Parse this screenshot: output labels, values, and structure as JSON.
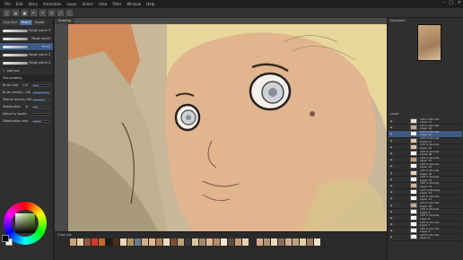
{
  "menu": [
    "File",
    "Edit",
    "Story",
    "Animation",
    "Layer",
    "Select",
    "View",
    "Filter",
    "Window",
    "Help"
  ],
  "tool_panel": {
    "tabs": [
      "Sub Tool",
      "Pencil",
      "Pastel"
    ],
    "brushes": [
      {
        "name": "Rough pencil 3",
        "selected": false
      },
      {
        "name": "Rough pencil",
        "selected": false
      },
      {
        "name": "Pencil",
        "selected": true
      },
      {
        "name": "Rough pencil 2",
        "selected": false
      },
      {
        "name": "Rough pencil 4",
        "selected": false
      }
    ],
    "add_button": "Add tool",
    "properties_title": "Tool property",
    "props": [
      {
        "label": "Brush Size",
        "value": "4.0",
        "level": 0.35
      },
      {
        "label": "Brush density",
        "value": "100",
        "level": 1.0
      },
      {
        "label": "Texture density",
        "value": "100",
        "level": 0.7
      },
      {
        "label": "Stabilization",
        "value": "6",
        "level": 0.3
      },
      {
        "label": "Adjust by speed",
        "value": "",
        "level": 0
      },
      {
        "label": "Stabilization step",
        "value": "",
        "level": 0.5
      }
    ]
  },
  "canvas": {
    "tab_label": "drawing"
  },
  "palette": {
    "label": "Color set",
    "colors": [
      "#c7a27a",
      "#e6c9a8",
      "#8a5a3c",
      "#d33a2c",
      "#c96a2a",
      "#1b1b1b",
      "#4b2a1d",
      "#e9d9b5",
      "#b3935f",
      "#6b7a8f",
      "#cfb08a",
      "#e3b48f",
      "#a77a57",
      "#f1dcc3",
      "#7a4e33",
      "#c2a076",
      "#3a3a3a",
      "#d9c49a",
      "#9e8a6a",
      "#e0b590",
      "#bb8a66",
      "#f4e6cf",
      "#5d4a3a",
      "#c79a78",
      "#e6d2ad",
      "#2a2a2a",
      "#d8a88a",
      "#a99272",
      "#efd7bb",
      "#85705a",
      "#cfae8c",
      "#b9a582",
      "#e7cfa4",
      "#9d7b5c",
      "#f0e0c5"
    ]
  },
  "right_panel": {
    "navigator_label": "Navigator",
    "layer_label": "Layer",
    "layers": [
      {
        "name": "100 % Normal",
        "sub": "Layer 23",
        "selected": false,
        "thumb": "#e8e3d6"
      },
      {
        "name": "100 % Normal",
        "sub": "Layer 19",
        "selected": false,
        "thumb": "#c9a888"
      },
      {
        "name": "100 % Normal",
        "sub": "Layer 22",
        "selected": true,
        "thumb": "#ffffff"
      },
      {
        "name": "100 % Normal",
        "sub": "Layer 21",
        "selected": false,
        "thumb": "#e0c7a9"
      },
      {
        "name": "100 % Normal",
        "sub": "Layer 20",
        "selected": false,
        "thumb": "#dcc2a2"
      },
      {
        "name": "100 % Normal",
        "sub": "Layer 18",
        "selected": false,
        "thumb": "#ffffff"
      },
      {
        "name": "100 % Normal",
        "sub": "Layer 17",
        "selected": false,
        "thumb": "#c89f7f"
      },
      {
        "name": "100 % Normal",
        "sub": "Layer 16",
        "selected": false,
        "thumb": "#ffffff"
      },
      {
        "name": "100 % Normal",
        "sub": "Layer 15",
        "selected": false,
        "thumb": "#e9d2b2"
      },
      {
        "name": "100 % Normal",
        "sub": "Layer 14",
        "selected": false,
        "thumb": "#ffffff"
      },
      {
        "name": "100 % Normal",
        "sub": "Layer 13",
        "selected": false,
        "thumb": "#d3b593"
      },
      {
        "name": "100 % Multiply",
        "sub": "Layer 12",
        "selected": false,
        "thumb": "#ffffff"
      },
      {
        "name": "100 % Normal",
        "sub": "Layer 11",
        "selected": false,
        "thumb": "#ffffff"
      },
      {
        "name": "100 % Normal",
        "sub": "Layer 10",
        "selected": false,
        "thumb": "#c9a888"
      },
      {
        "name": "100 % Normal",
        "sub": "Layer 9",
        "selected": false,
        "thumb": "#ffffff"
      },
      {
        "name": "100 % Normal",
        "sub": "Layer 8",
        "selected": false,
        "thumb": "#ffffff"
      },
      {
        "name": "100 % Normal",
        "sub": "Layer 7",
        "selected": false,
        "thumb": "#ffffff"
      },
      {
        "name": "100 % Normal",
        "sub": "Layer 6",
        "selected": false,
        "thumb": "#ffffff"
      },
      {
        "name": "100 % Normal",
        "sub": "Layer 5",
        "selected": false,
        "thumb": "#ffffff"
      }
    ]
  },
  "colors": {
    "accent": "#3e5a85",
    "skin": "#e1b58e",
    "hair": "#e8d79a",
    "bg_art": "#c9b79a"
  }
}
